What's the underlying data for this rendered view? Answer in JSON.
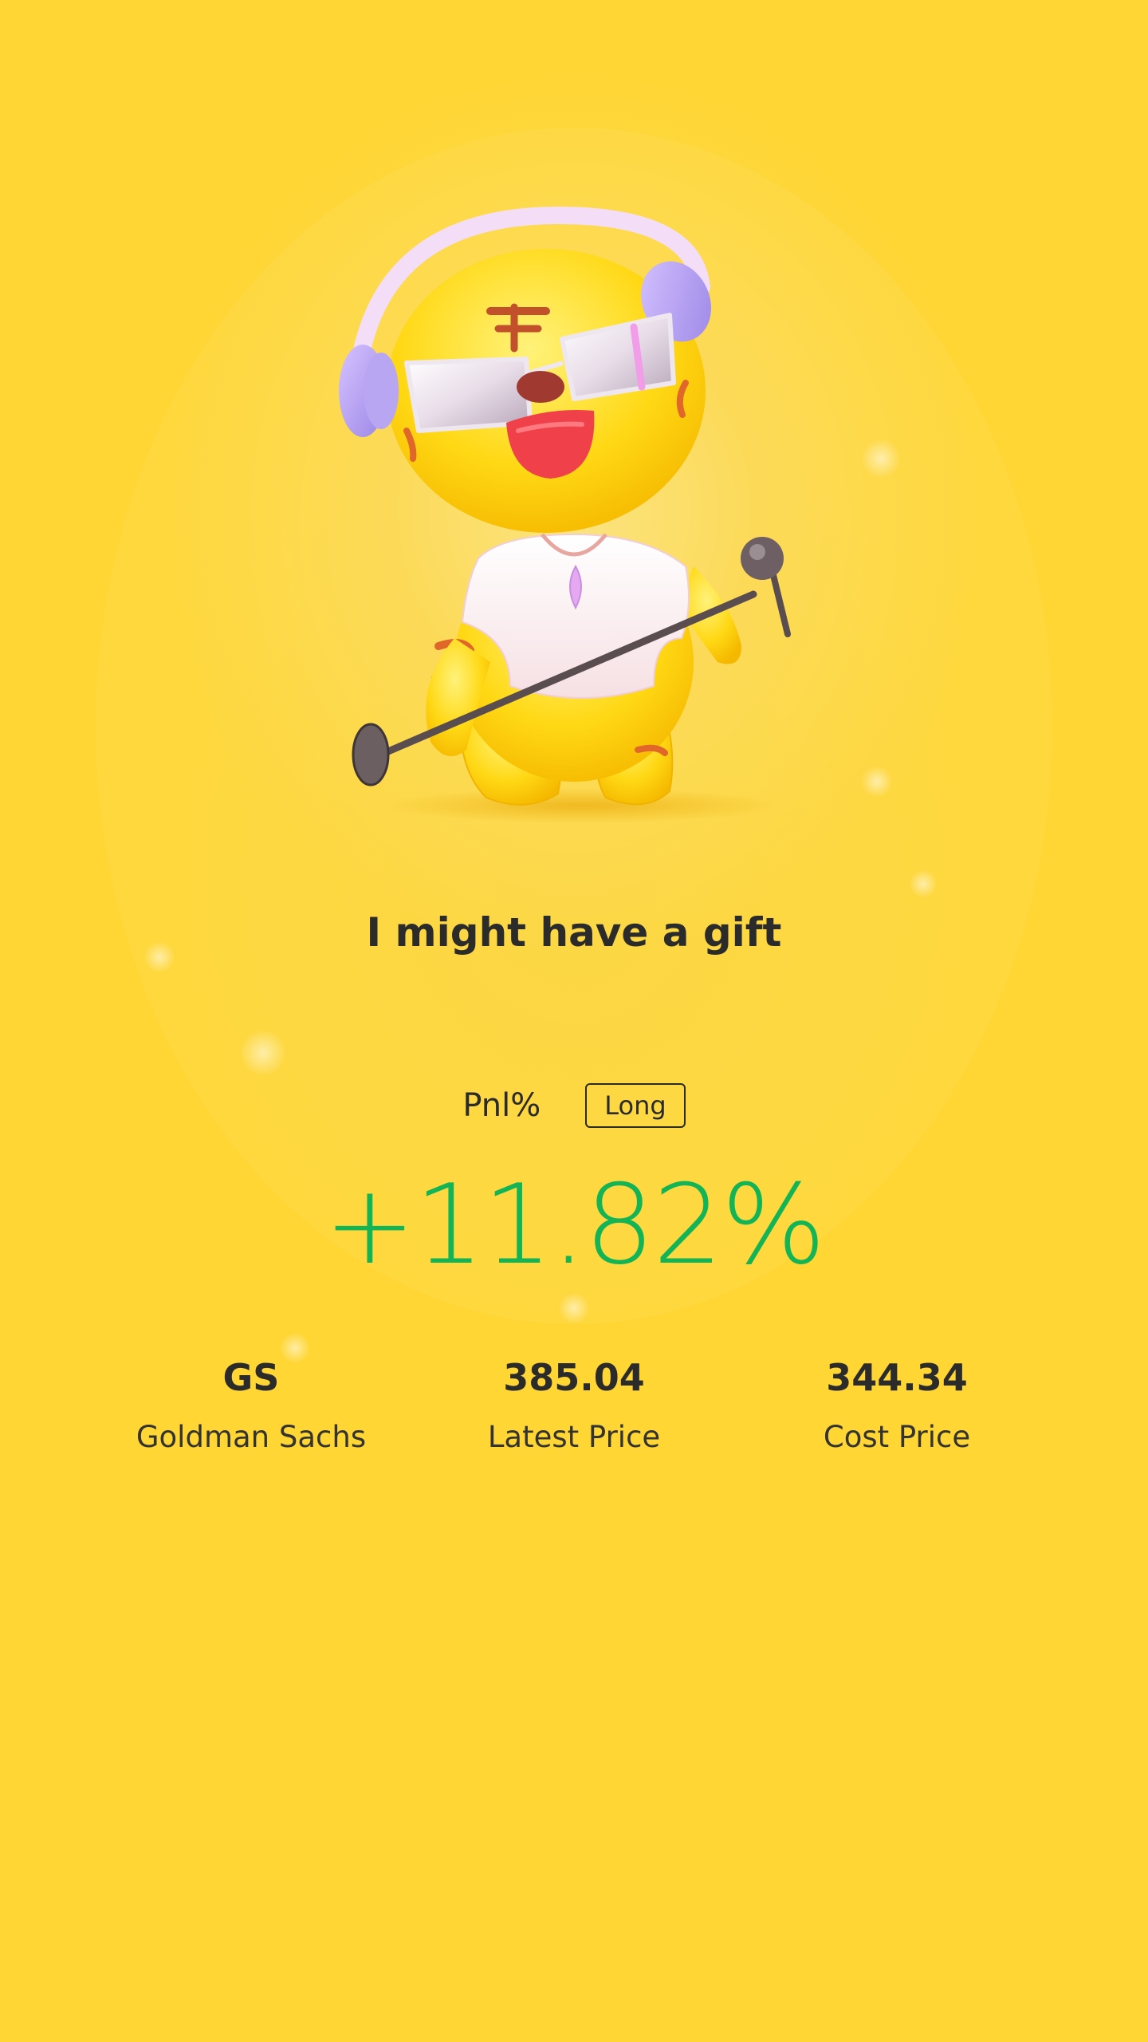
{
  "headline": "I might have a gift",
  "pnl": {
    "label": "Pnl%",
    "side": "Long",
    "value": "+11.82%",
    "value_color": "#12b455"
  },
  "stats": [
    {
      "value": "GS",
      "label": "Goldman Sachs"
    },
    {
      "value": "385.04",
      "label": "Latest Price"
    },
    {
      "value": "344.34",
      "label": "Cost Price"
    }
  ],
  "colors": {
    "background": "#ffd633",
    "text": "#2b2b2b"
  },
  "mascot": {
    "icon": "tiger-mascot-with-headphones-and-microphone"
  }
}
